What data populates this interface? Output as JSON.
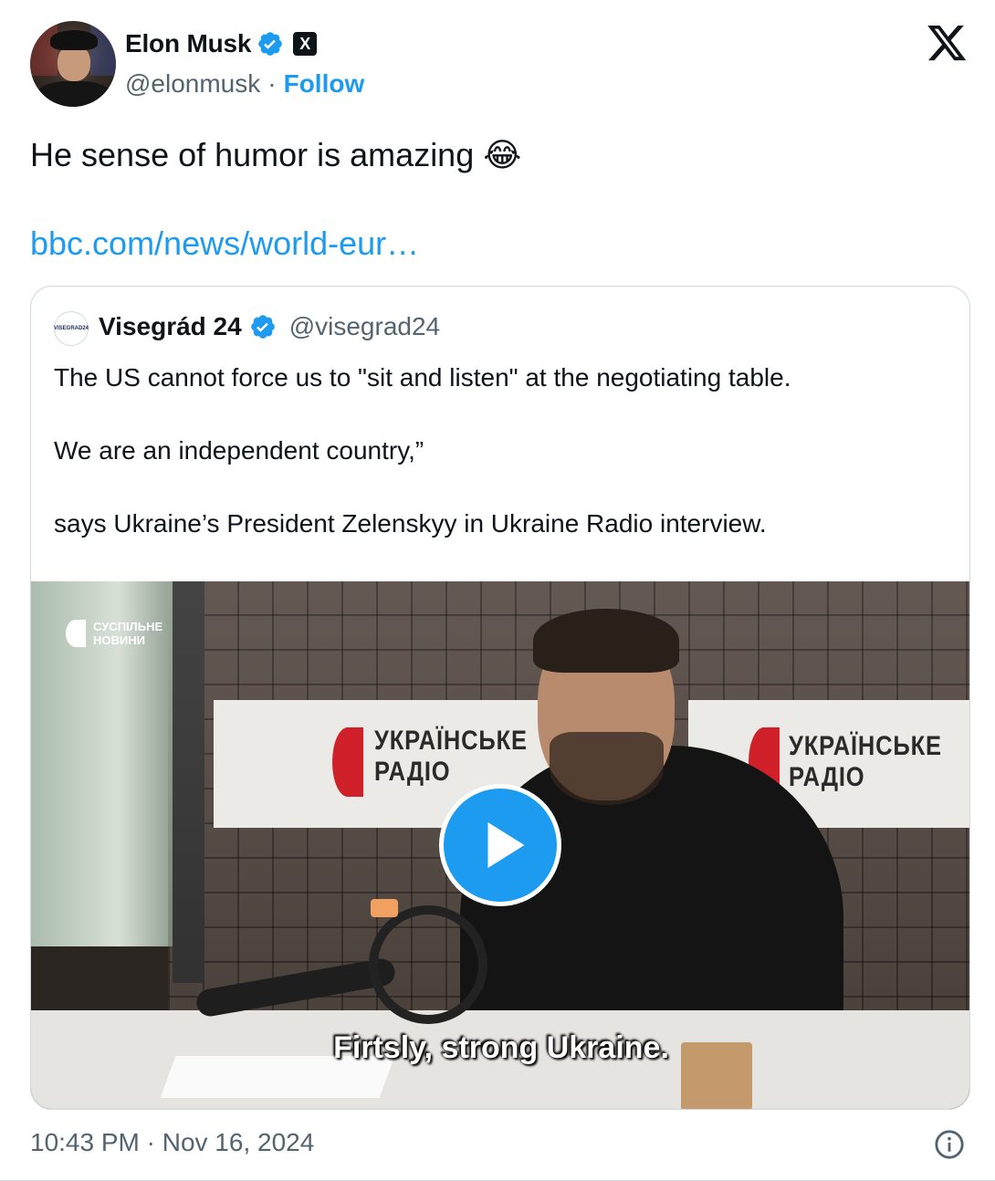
{
  "author": {
    "display_name": "Elon Musk",
    "handle": "@elonmusk",
    "separator": "·",
    "follow_label": "Follow",
    "verified_icon": "verified-badge-icon",
    "affiliate_badge": "X"
  },
  "platform_logo": "x-logo-icon",
  "tweet": {
    "text": "He sense of humor is amazing",
    "emoji": "😂",
    "link": "bbc.com/news/world-eur…"
  },
  "quote": {
    "avatar_text": "VISEGRAD24",
    "display_name": "Visegrád 24",
    "handle": "@visegrad24",
    "paragraphs": [
      "The US cannot force us to \"sit and listen\" at the negotiating table.",
      "We are an independent country,”",
      "says Ukraine’s President Zelenskyy in Ukraine Radio interview."
    ],
    "video": {
      "watermark_line1": "СУСПІЛЬНЕ",
      "watermark_line2": "НОВИНИ",
      "sign_line1": "УКРАЇНСЬКЕ",
      "sign_line2": "РАДІО",
      "subtitle": "Firtsly, strong Ukraine.",
      "play_icon": "play-icon"
    }
  },
  "footer": {
    "timestamp": "10:43 PM · Nov 16, 2024",
    "info_icon": "info-icon"
  },
  "colors": {
    "accent": "#1d9bf0",
    "text": "#0f1419",
    "muted": "#536471",
    "border": "#cfd9de",
    "sign_red": "#d0202a"
  }
}
